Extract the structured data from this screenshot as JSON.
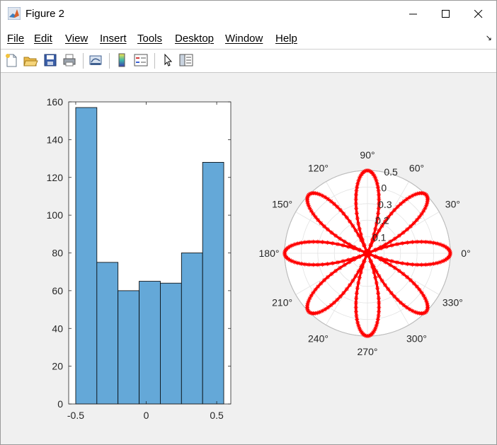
{
  "window": {
    "title": "Figure 2"
  },
  "menu": [
    "File",
    "Edit",
    "View",
    "Insert",
    "Tools",
    "Desktop",
    "Window",
    "Help"
  ],
  "toolbar": {
    "icons": [
      "new-figure-icon",
      "open-file-icon",
      "save-icon",
      "print-icon",
      "link-icon",
      "colorbar-icon",
      "legend-icon",
      "pointer-icon",
      "property-inspector-icon"
    ]
  },
  "chart_data": [
    {
      "type": "bar",
      "subtype": "histogram",
      "bin_edges": [
        -0.5,
        -0.35,
        -0.2,
        -0.05,
        0.1,
        0.25,
        0.4,
        0.55
      ],
      "values": [
        157,
        75,
        60,
        65,
        64,
        80,
        128
      ],
      "xlim": [
        -0.55,
        0.6
      ],
      "ylim": [
        0,
        160
      ],
      "xticks": [
        "-0.5",
        "0",
        "0.5"
      ],
      "yticks": [
        "0",
        "20",
        "40",
        "60",
        "80",
        "100",
        "120",
        "140",
        "160"
      ],
      "bar_color": "#64a8d8",
      "edge_color": "#000000",
      "grid": false
    },
    {
      "type": "scatter",
      "subtype": "polar",
      "equation": "r = 0.5·|cos(4θ)|",
      "marker": "*",
      "color": "#ff0000",
      "rmax": 0.5,
      "rtick_labels": [
        "0.5",
        "0",
        "0.3",
        "0.2",
        "0.1"
      ],
      "theta_labels": [
        "0°",
        "30°",
        "60°",
        "90°",
        "120°",
        "150°",
        "180°",
        "210°",
        "240°",
        "270°",
        "300°",
        "330°"
      ],
      "grid": true
    }
  ]
}
